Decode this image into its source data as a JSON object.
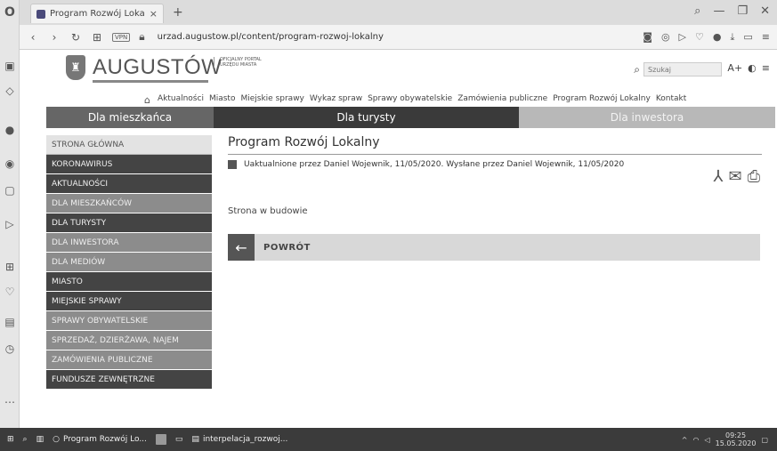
{
  "browser": {
    "tab_title": "Program Rozwój Lokalny |",
    "tab_close": "×",
    "new_tab": "+",
    "url": "urzad.augustow.pl/content/program-rozwoj-lokalny",
    "vpn_label": "VPN"
  },
  "site": {
    "logo_text": "AUGUSTÓW",
    "portal_text": "OFICJALNY PORTAL URZĘDU MIASTA",
    "search_placeholder": "Szukaj",
    "font_size_label": "A+"
  },
  "topnav": [
    "Aktualności",
    "Miasto",
    "Miejskie sprawy",
    "Wykaz spraw",
    "Sprawy obywatelskie",
    "Zamówienia publiczne",
    "Program Rozwój Lokalny",
    "Kontakt"
  ],
  "bands": [
    "Dla mieszkańca",
    "Dla turysty",
    "Dla inwestora"
  ],
  "menu": [
    {
      "label": "STRONA GŁÓWNA",
      "style": "light"
    },
    {
      "label": "KORONAWIRUS",
      "style": "dark"
    },
    {
      "label": "AKTUALNOŚCI",
      "style": "dark"
    },
    {
      "label": "DLA MIESZKAŃCÓW",
      "style": "mid"
    },
    {
      "label": "DLA TURYSTY",
      "style": "dark"
    },
    {
      "label": "DLA INWESTORA",
      "style": "mid"
    },
    {
      "label": "DLA MEDIÓW",
      "style": "mid"
    },
    {
      "label": "MIASTO",
      "style": "dark"
    },
    {
      "label": "MIEJSKIE SPRAWY",
      "style": "dark"
    },
    {
      "label": "SPRAWY OBYWATELSKIE",
      "style": "mid"
    },
    {
      "label": "SPRZEDAŻ, DZIERŻAWA, NAJEM",
      "style": "mid"
    },
    {
      "label": "ZAMÓWIENIA PUBLICZNE",
      "style": "mid"
    },
    {
      "label": "FUNDUSZE ZEWNĘTRZNE",
      "style": "dark"
    }
  ],
  "main": {
    "title": "Program Rozwój Lokalny",
    "meta": "Uaktualnione przez Daniel Wojewnik, 11/05/2020. Wysłane przez Daniel Wojewnik, 11/05/2020",
    "body": "Strona w budowie",
    "back_label": "POWRÓT"
  },
  "taskbar": {
    "item1": "Program Rozwój Lo...",
    "item2": "interpelacja_rozwoj...",
    "time": "09:25",
    "date": "15.05.2020"
  }
}
